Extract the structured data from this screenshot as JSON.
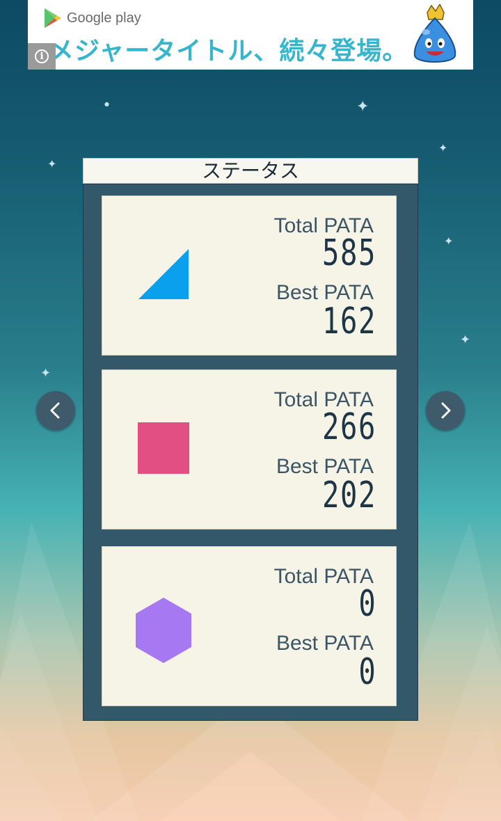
{
  "ad": {
    "store_name": "Google play",
    "headline": "メジャータイトル、続々登場。",
    "info_label": "i"
  },
  "panel": {
    "title": "ステータス"
  },
  "stats": [
    {
      "shape": "triangle",
      "color": "#0aa0ee",
      "total_label": "Total PATA",
      "total_value": "585",
      "best_label": "Best PATA",
      "best_value": "162"
    },
    {
      "shape": "square",
      "color": "#e24f83",
      "total_label": "Total PATA",
      "total_value": "266",
      "best_label": "Best PATA",
      "best_value": "202"
    },
    {
      "shape": "hexagon",
      "color": "#a678f2",
      "total_label": "Total PATA",
      "total_value": "0",
      "best_label": "Best PATA",
      "best_value": "0"
    }
  ],
  "navigation": {
    "prev_icon": "chevron-left-icon",
    "next_icon": "chevron-right-icon"
  },
  "colors": {
    "panel_bg": "#33586a",
    "card_bg": "#f6f4e7",
    "nav_button": "#3f5a6b"
  }
}
